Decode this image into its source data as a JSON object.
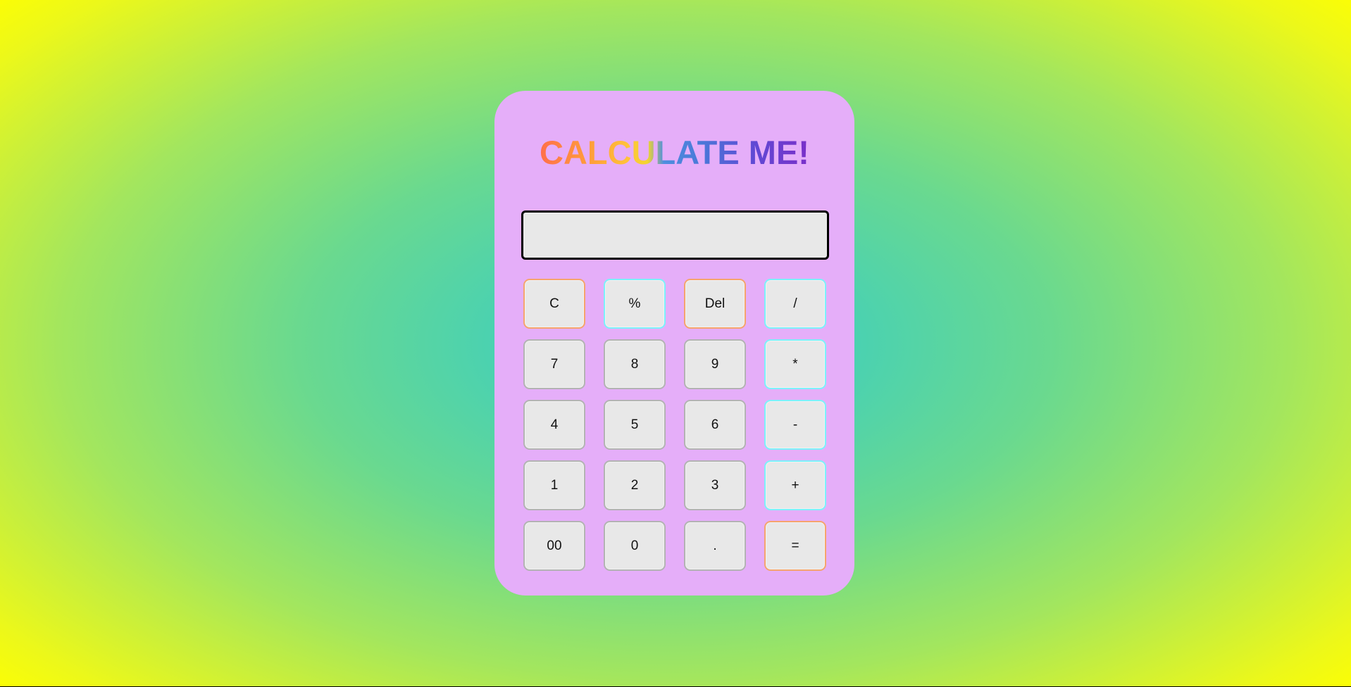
{
  "app": {
    "title": "CALCULATE ME!"
  },
  "display": {
    "value": ""
  },
  "keys": [
    {
      "label": "C",
      "name": "clear-button",
      "accent": "orange"
    },
    {
      "label": "%",
      "name": "percent-button",
      "accent": "cyan"
    },
    {
      "label": "Del",
      "name": "delete-button",
      "accent": "orange"
    },
    {
      "label": "/",
      "name": "divide-button",
      "accent": "cyan"
    },
    {
      "label": "7",
      "name": "digit-7-button",
      "accent": "none"
    },
    {
      "label": "8",
      "name": "digit-8-button",
      "accent": "none"
    },
    {
      "label": "9",
      "name": "digit-9-button",
      "accent": "none"
    },
    {
      "label": "*",
      "name": "multiply-button",
      "accent": "cyan"
    },
    {
      "label": "4",
      "name": "digit-4-button",
      "accent": "none"
    },
    {
      "label": "5",
      "name": "digit-5-button",
      "accent": "none"
    },
    {
      "label": "6",
      "name": "digit-6-button",
      "accent": "none"
    },
    {
      "label": "-",
      "name": "subtract-button",
      "accent": "cyan"
    },
    {
      "label": "1",
      "name": "digit-1-button",
      "accent": "none"
    },
    {
      "label": "2",
      "name": "digit-2-button",
      "accent": "none"
    },
    {
      "label": "3",
      "name": "digit-3-button",
      "accent": "none"
    },
    {
      "label": "+",
      "name": "add-button",
      "accent": "cyan"
    },
    {
      "label": "00",
      "name": "double-zero-button",
      "accent": "none"
    },
    {
      "label": "0",
      "name": "digit-0-button",
      "accent": "none"
    },
    {
      "label": ".",
      "name": "decimal-point-button",
      "accent": "none"
    },
    {
      "label": "=",
      "name": "equals-button",
      "accent": "orange"
    }
  ],
  "colors": {
    "panel": "#e5aef9",
    "key_background": "#e8e8e8",
    "key_border": "#b3b3b3",
    "accent_orange": "#f5a46d",
    "accent_cyan": "#7cf1fa",
    "background_center": "#2ecbcf",
    "background_edge": "#ffff00"
  }
}
